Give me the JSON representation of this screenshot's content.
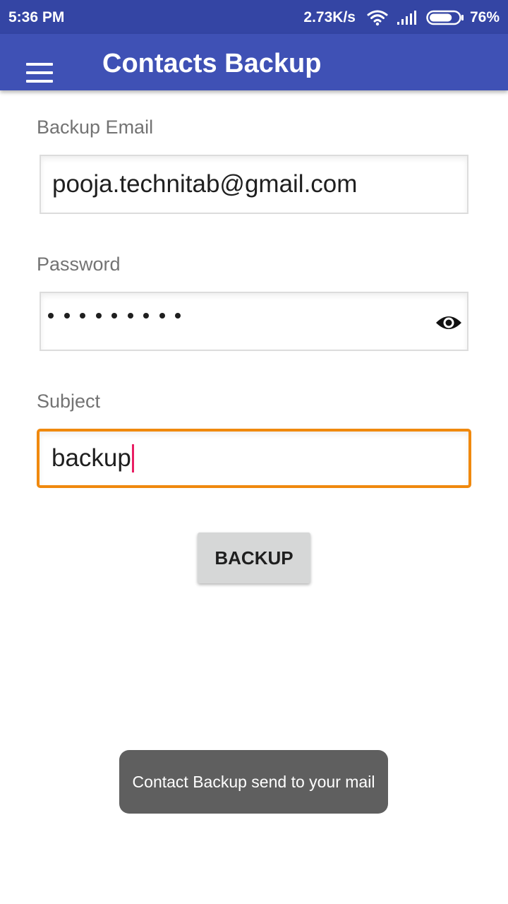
{
  "status_bar": {
    "time": "5:36 PM",
    "network_speed": "2.73K/s",
    "battery_percent": "76%",
    "battery_level": 0.76,
    "icons": [
      "wifi-icon",
      "signal-icon",
      "battery-icon"
    ]
  },
  "app_bar": {
    "title": "Contacts Backup",
    "menu_icon": "hamburger-menu-icon",
    "background_color": "#3f51b5"
  },
  "form": {
    "email": {
      "label": "Backup Email",
      "value": "pooja.technitab@gmail.com"
    },
    "password": {
      "label": "Password",
      "masked_length": 9,
      "toggle_icon": "eye-icon"
    },
    "subject": {
      "label": "Subject",
      "value": "backup",
      "focused": true,
      "focus_color": "#f0890e",
      "cursor_color": "#e91e63"
    },
    "submit_label": "BACKUP"
  },
  "toast": {
    "message": "Contact Backup send to your mail"
  }
}
